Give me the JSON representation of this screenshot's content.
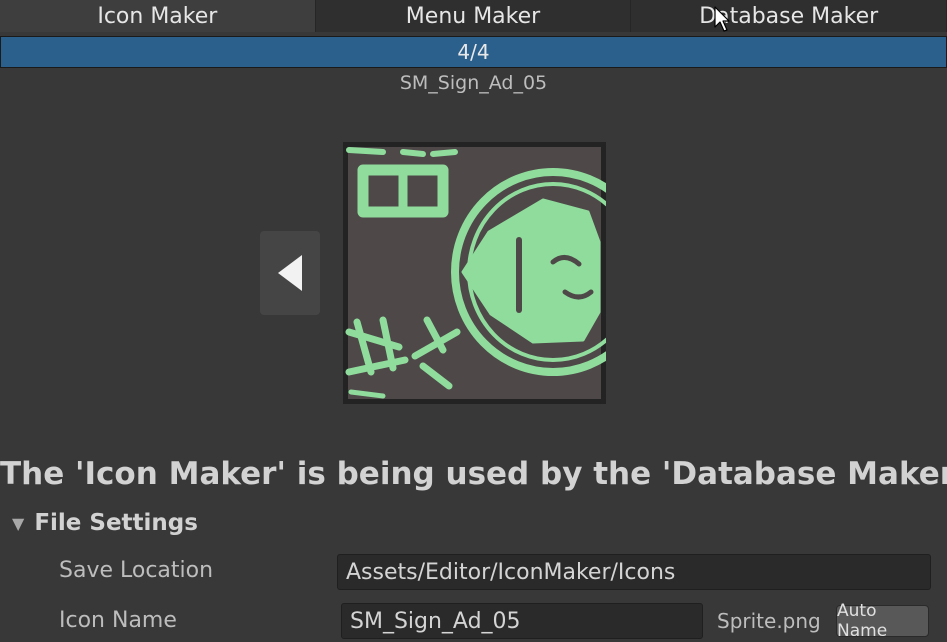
{
  "tabs": [
    {
      "label": "Icon Maker"
    },
    {
      "label": "Menu Maker"
    },
    {
      "label": "Database Maker"
    }
  ],
  "progress": {
    "text": "4/4",
    "fraction": 1.0,
    "color": "#2b5f8c"
  },
  "asset_name": "SM_Sign_Ad_05",
  "preview": {
    "icon": "sign-ad-preview-image",
    "accent": "#8fdc9c",
    "background": "#4e4848"
  },
  "nav": {
    "prev_icon": "triangle-left-icon"
  },
  "headline": "The 'Icon Maker' is being used by the 'Database Maker'",
  "file_settings": {
    "title": "File Settings",
    "save_location": {
      "label": "Save Location",
      "value": "Assets/Editor/IconMaker/Icons"
    },
    "icon_name": {
      "label": "Icon Name",
      "value": "SM_Sign_Ad_05",
      "suffix": "Sprite.png",
      "auto_name_label": "Auto Name"
    }
  }
}
